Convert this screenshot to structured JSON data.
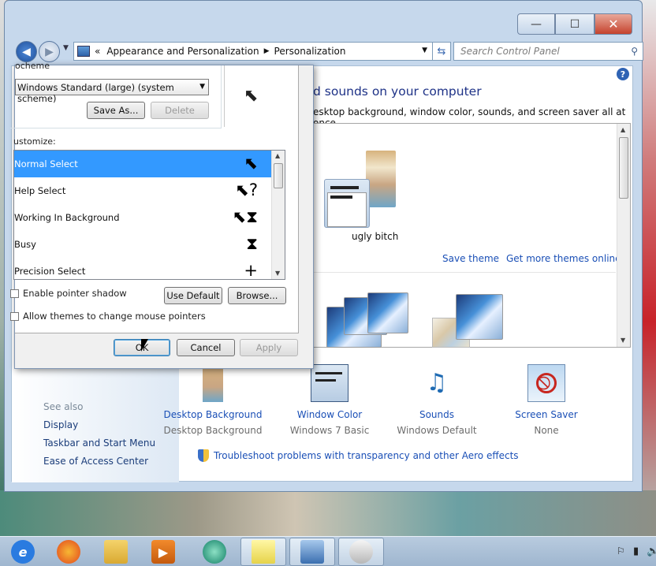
{
  "window": {
    "address": {
      "root": "«",
      "crumb1": "Appearance and Personalization",
      "crumb2": "Personalization"
    },
    "search_placeholder": "Search Control Panel",
    "caption": {
      "minimize": "—",
      "maximize": "☐",
      "close": "✕"
    }
  },
  "personalization": {
    "title": "Change the visuals and sounds on your computer",
    "title_visible": "d sounds on your computer",
    "desc_visible": "esktop background, window color, sounds, and screen saver all at once.",
    "theme_name": "ugly bitch",
    "save_theme": "Save theme",
    "more_themes": "Get more themes online",
    "bottom": [
      {
        "label": "Desktop Background",
        "value": "Desktop Background"
      },
      {
        "label": "Window Color",
        "value": "Windows 7 Basic"
      },
      {
        "label": "Sounds",
        "value": "Windows Default"
      },
      {
        "label": "Screen Saver",
        "value": "None"
      }
    ],
    "troubleshoot": "Troubleshoot problems with transparency and other Aero effects",
    "see_also": "See also",
    "see_also_links": [
      "Display",
      "Taskbar and Start Menu",
      "Ease of Access Center"
    ]
  },
  "dialog": {
    "scheme_label": "Scheme",
    "scheme_visible": "ocheme",
    "scheme_value": "Windows Standard (large) (system scheme)",
    "save_as": "Save As...",
    "delete": "Delete",
    "customize_label": "ustomize:",
    "cursors": [
      {
        "name": "Normal Select",
        "shown": "Normal Select",
        "glyph": "⬉"
      },
      {
        "name": "Help Select",
        "shown": "Help Select",
        "glyph": "⬉?"
      },
      {
        "name": "Working In Background",
        "shown": "Working In Background",
        "glyph": "⬉⧗"
      },
      {
        "name": "Busy",
        "shown": "Busy",
        "glyph": "⧗"
      },
      {
        "name": "Precision Select",
        "shown": "Precision Select",
        "glyph": "+"
      }
    ],
    "enable_shadow": "Enable pointer shadow",
    "allow_themes": "Allow themes to change mouse pointers",
    "use_default": "Use Default",
    "browse": "Browse...",
    "ok": "OK",
    "cancel": "Cancel",
    "apply": "Apply"
  },
  "taskbar": {
    "items": [
      "internet-explorer",
      "firefox",
      "windows-explorer",
      "media-player",
      "bluetooth-app",
      "sticky-notes",
      "control-panel",
      "mouse-properties"
    ]
  }
}
